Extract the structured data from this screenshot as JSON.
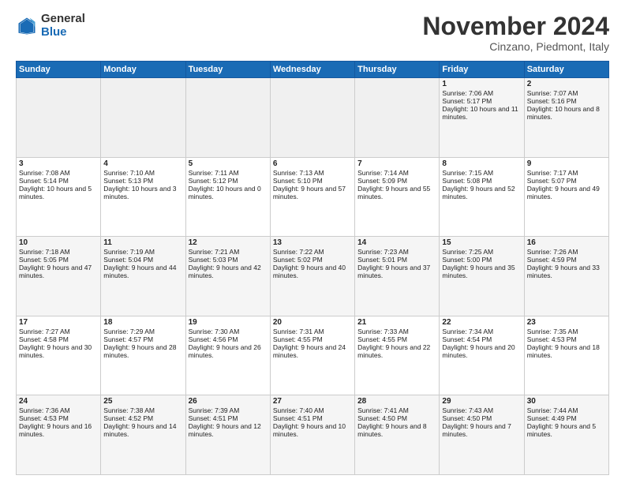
{
  "logo": {
    "line1": "General",
    "line2": "Blue"
  },
  "title": "November 2024",
  "subtitle": "Cinzano, Piedmont, Italy",
  "headers": [
    "Sunday",
    "Monday",
    "Tuesday",
    "Wednesday",
    "Thursday",
    "Friday",
    "Saturday"
  ],
  "rows": [
    [
      {
        "day": "",
        "text": ""
      },
      {
        "day": "",
        "text": ""
      },
      {
        "day": "",
        "text": ""
      },
      {
        "day": "",
        "text": ""
      },
      {
        "day": "",
        "text": ""
      },
      {
        "day": "1",
        "text": "Sunrise: 7:06 AM\nSunset: 5:17 PM\nDaylight: 10 hours and 11 minutes."
      },
      {
        "day": "2",
        "text": "Sunrise: 7:07 AM\nSunset: 5:16 PM\nDaylight: 10 hours and 8 minutes."
      }
    ],
    [
      {
        "day": "3",
        "text": "Sunrise: 7:08 AM\nSunset: 5:14 PM\nDaylight: 10 hours and 5 minutes."
      },
      {
        "day": "4",
        "text": "Sunrise: 7:10 AM\nSunset: 5:13 PM\nDaylight: 10 hours and 3 minutes."
      },
      {
        "day": "5",
        "text": "Sunrise: 7:11 AM\nSunset: 5:12 PM\nDaylight: 10 hours and 0 minutes."
      },
      {
        "day": "6",
        "text": "Sunrise: 7:13 AM\nSunset: 5:10 PM\nDaylight: 9 hours and 57 minutes."
      },
      {
        "day": "7",
        "text": "Sunrise: 7:14 AM\nSunset: 5:09 PM\nDaylight: 9 hours and 55 minutes."
      },
      {
        "day": "8",
        "text": "Sunrise: 7:15 AM\nSunset: 5:08 PM\nDaylight: 9 hours and 52 minutes."
      },
      {
        "day": "9",
        "text": "Sunrise: 7:17 AM\nSunset: 5:07 PM\nDaylight: 9 hours and 49 minutes."
      }
    ],
    [
      {
        "day": "10",
        "text": "Sunrise: 7:18 AM\nSunset: 5:05 PM\nDaylight: 9 hours and 47 minutes."
      },
      {
        "day": "11",
        "text": "Sunrise: 7:19 AM\nSunset: 5:04 PM\nDaylight: 9 hours and 44 minutes."
      },
      {
        "day": "12",
        "text": "Sunrise: 7:21 AM\nSunset: 5:03 PM\nDaylight: 9 hours and 42 minutes."
      },
      {
        "day": "13",
        "text": "Sunrise: 7:22 AM\nSunset: 5:02 PM\nDaylight: 9 hours and 40 minutes."
      },
      {
        "day": "14",
        "text": "Sunrise: 7:23 AM\nSunset: 5:01 PM\nDaylight: 9 hours and 37 minutes."
      },
      {
        "day": "15",
        "text": "Sunrise: 7:25 AM\nSunset: 5:00 PM\nDaylight: 9 hours and 35 minutes."
      },
      {
        "day": "16",
        "text": "Sunrise: 7:26 AM\nSunset: 4:59 PM\nDaylight: 9 hours and 33 minutes."
      }
    ],
    [
      {
        "day": "17",
        "text": "Sunrise: 7:27 AM\nSunset: 4:58 PM\nDaylight: 9 hours and 30 minutes."
      },
      {
        "day": "18",
        "text": "Sunrise: 7:29 AM\nSunset: 4:57 PM\nDaylight: 9 hours and 28 minutes."
      },
      {
        "day": "19",
        "text": "Sunrise: 7:30 AM\nSunset: 4:56 PM\nDaylight: 9 hours and 26 minutes."
      },
      {
        "day": "20",
        "text": "Sunrise: 7:31 AM\nSunset: 4:55 PM\nDaylight: 9 hours and 24 minutes."
      },
      {
        "day": "21",
        "text": "Sunrise: 7:33 AM\nSunset: 4:55 PM\nDaylight: 9 hours and 22 minutes."
      },
      {
        "day": "22",
        "text": "Sunrise: 7:34 AM\nSunset: 4:54 PM\nDaylight: 9 hours and 20 minutes."
      },
      {
        "day": "23",
        "text": "Sunrise: 7:35 AM\nSunset: 4:53 PM\nDaylight: 9 hours and 18 minutes."
      }
    ],
    [
      {
        "day": "24",
        "text": "Sunrise: 7:36 AM\nSunset: 4:53 PM\nDaylight: 9 hours and 16 minutes."
      },
      {
        "day": "25",
        "text": "Sunrise: 7:38 AM\nSunset: 4:52 PM\nDaylight: 9 hours and 14 minutes."
      },
      {
        "day": "26",
        "text": "Sunrise: 7:39 AM\nSunset: 4:51 PM\nDaylight: 9 hours and 12 minutes."
      },
      {
        "day": "27",
        "text": "Sunrise: 7:40 AM\nSunset: 4:51 PM\nDaylight: 9 hours and 10 minutes."
      },
      {
        "day": "28",
        "text": "Sunrise: 7:41 AM\nSunset: 4:50 PM\nDaylight: 9 hours and 8 minutes."
      },
      {
        "day": "29",
        "text": "Sunrise: 7:43 AM\nSunset: 4:50 PM\nDaylight: 9 hours and 7 minutes."
      },
      {
        "day": "30",
        "text": "Sunrise: 7:44 AM\nSunset: 4:49 PM\nDaylight: 9 hours and 5 minutes."
      }
    ]
  ]
}
